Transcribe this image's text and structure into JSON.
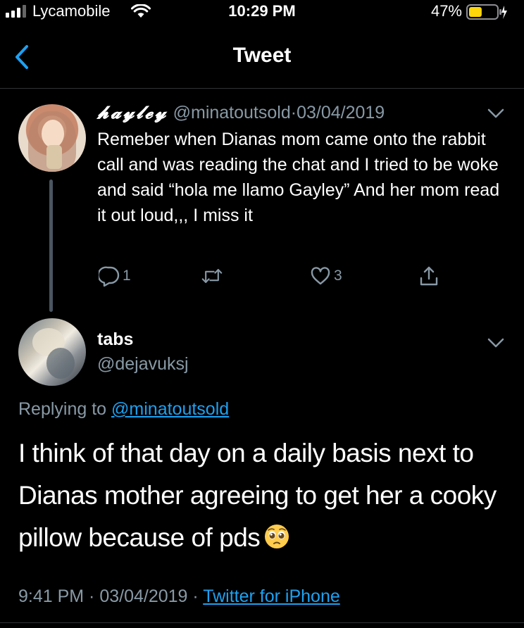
{
  "status_bar": {
    "carrier": "Lycamobile",
    "time": "10:29 PM",
    "battery_percent": "47%",
    "battery_level": 0.47,
    "battery_color": "#ffd60a"
  },
  "nav": {
    "title": "Tweet",
    "back_icon": "chevron-left-icon"
  },
  "original_tweet": {
    "display_name": "𝓱𝓪𝔂𝓵𝓮𝔂",
    "handle": "@minatoutsold",
    "separator": "·",
    "date": "03/04/2019",
    "text": "Remeber when Dianas mom came onto the rabbit call and was reading the chat and I tried to be woke and said “hola me llamo Gayley” And her mom read it out loud,,, I miss it",
    "actions": {
      "reply_count": "1",
      "retweet_count": "",
      "like_count": "3"
    }
  },
  "reply_tweet": {
    "display_name": "tabs",
    "handle": "@dejavuksj",
    "replying_prefix": "Replying to ",
    "replying_to": "@minatoutsold",
    "text": "I think of that day on a daily basis next to Dianas mother agreeing to get her a cooky pillow because of pds",
    "emoji": "pleading-face",
    "time": "9:41 PM",
    "separator": " · ",
    "date": "03/04/2019",
    "source": "Twitter for iPhone"
  },
  "colors": {
    "background": "#000000",
    "text": "#ffffff",
    "secondary": "#8899a6",
    "accent": "#1da1f2",
    "divider": "#2f3336"
  }
}
